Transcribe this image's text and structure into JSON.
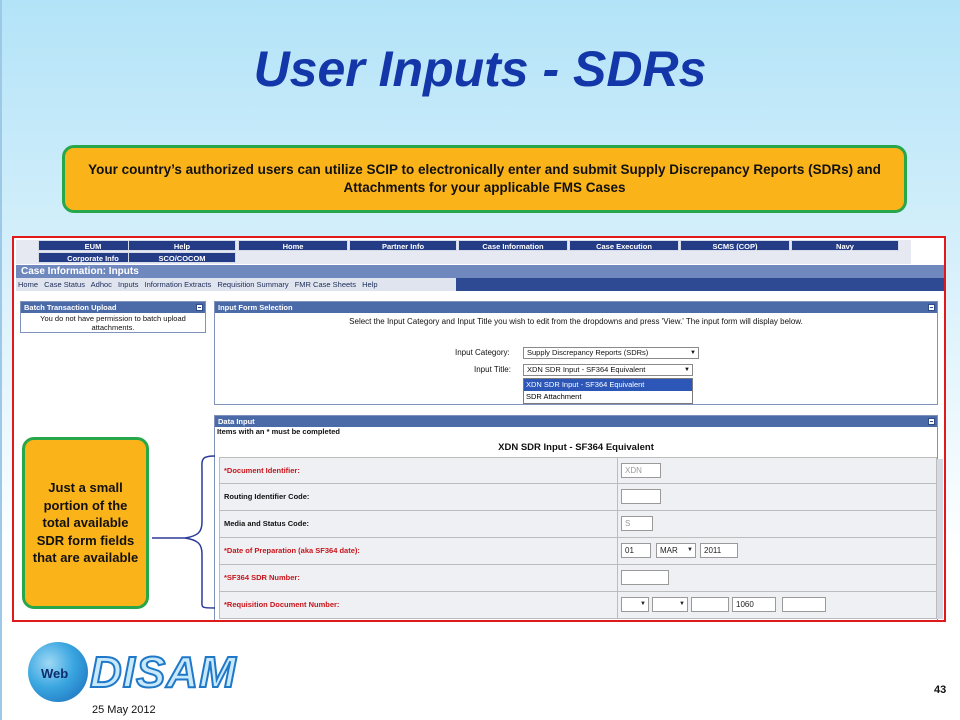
{
  "slide": {
    "title": "User Inputs - SDRs",
    "callout_top": "Your country’s authorized users can utilize SCIP to electronically enter and submit Supply Discrepancy Reports (SDRs) and Attachments for your  applicable FMS Cases",
    "callout_left": "Just a small portion of the total available SDR form fields that are available",
    "date": "25 May 2012",
    "page_number": "43",
    "logo_web": "Web",
    "logo_word": "DISAM"
  },
  "colors": {
    "title": "#1336a8",
    "callout_fill": "#fbb31a",
    "callout_border": "#27a64a",
    "screenshot_border": "#e0191b",
    "nav_button": "#243c86",
    "required_label": "#c8141a"
  },
  "scip": {
    "nav_row1": [
      "EUM",
      "Help",
      "Home",
      "Partner Info",
      "Case Information",
      "Case Execution",
      "SCMS (COP)",
      "Navy"
    ],
    "nav_row2": [
      "Corporate Info",
      "SCO/COCOM"
    ],
    "section_title": "Case Information: Inputs",
    "sub_nav": [
      "Home",
      "Case Status",
      "Adhoc",
      "Inputs",
      "Information Extracts",
      "Requisition Summary",
      "FMR Case Sheets",
      "Help"
    ],
    "batch_panel": {
      "title": "Batch Transaction Upload",
      "message": "You do not have permission to batch upload attachments."
    },
    "input_form_selection": {
      "title": "Input Form Selection",
      "instructions": "Select the Input Category and Input Title you wish to edit from the dropdowns and press 'View.' The input form will display below.",
      "category_label": "Input Category:",
      "category_value": "Supply Discrepancy Reports (SDRs)",
      "title_label": "Input Title:",
      "title_value": "XDN SDR Input - SF364 Equivalent",
      "title_options": [
        "XDN SDR Input - SF364 Equivalent",
        "SDR Attachment"
      ]
    },
    "data_input": {
      "title": "Data Input",
      "note": "Items with an * must be completed",
      "form_title": "XDN SDR Input - SF364 Equivalent",
      "rows": [
        {
          "label": "*Document Identifier:",
          "value": "XDN"
        },
        {
          "label": "Routing Identifier Code:",
          "value": ""
        },
        {
          "label": "Media and Status Code:",
          "value": "S"
        },
        {
          "label": "*Date of Preparation (aka SF364 date):",
          "day": "01",
          "month": "MAR",
          "year": "2011"
        },
        {
          "label": "*SF364 SDR Number:",
          "value": ""
        },
        {
          "label": "*Requisition Document Number:",
          "value": "1060"
        }
      ]
    }
  }
}
